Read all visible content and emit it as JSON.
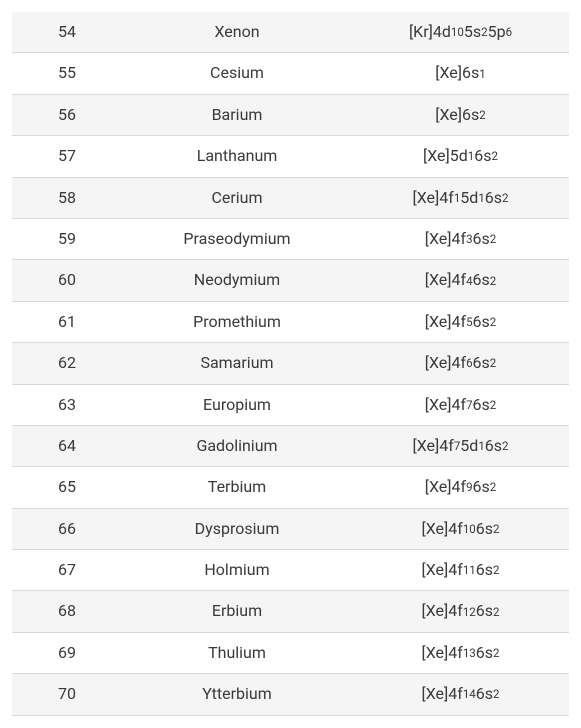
{
  "elements": [
    {
      "number": "54",
      "name": "Xenon",
      "config": [
        [
          "[Kr]4d",
          "10"
        ],
        [
          "5s",
          "2"
        ],
        [
          "5p",
          "6"
        ]
      ]
    },
    {
      "number": "55",
      "name": "Cesium",
      "config": [
        [
          "[Xe]6s",
          "1"
        ]
      ]
    },
    {
      "number": "56",
      "name": "Barium",
      "config": [
        [
          "[Xe]6s",
          "2"
        ]
      ]
    },
    {
      "number": "57",
      "name": "Lanthanum",
      "config": [
        [
          "[Xe]5d",
          "1"
        ],
        [
          "6s",
          "2"
        ]
      ]
    },
    {
      "number": "58",
      "name": "Cerium",
      "config": [
        [
          "[Xe]4f",
          "1"
        ],
        [
          "5d",
          "1"
        ],
        [
          "6s",
          "2"
        ]
      ]
    },
    {
      "number": "59",
      "name": "Praseodymium",
      "config": [
        [
          "[Xe]4f",
          "3"
        ],
        [
          "6s",
          "2"
        ]
      ]
    },
    {
      "number": "60",
      "name": "Neodymium",
      "config": [
        [
          "[Xe]4f",
          "4"
        ],
        [
          "6s",
          "2"
        ]
      ]
    },
    {
      "number": "61",
      "name": "Promethium",
      "config": [
        [
          "[Xe]4f",
          "5"
        ],
        [
          "6s",
          "2"
        ]
      ]
    },
    {
      "number": "62",
      "name": "Samarium",
      "config": [
        [
          "[Xe]4f",
          "6"
        ],
        [
          "6s",
          "2"
        ]
      ]
    },
    {
      "number": "63",
      "name": "Europium",
      "config": [
        [
          "[Xe]4f",
          "7"
        ],
        [
          "6s",
          "2"
        ]
      ]
    },
    {
      "number": "64",
      "name": "Gadolinium",
      "config": [
        [
          "[Xe]4f",
          "7"
        ],
        [
          "5d",
          "1"
        ],
        [
          "6s",
          "2"
        ]
      ]
    },
    {
      "number": "65",
      "name": "Terbium",
      "config": [
        [
          "[Xe]4f",
          "9"
        ],
        [
          "6s",
          "2"
        ]
      ]
    },
    {
      "number": "66",
      "name": "Dysprosium",
      "config": [
        [
          "[Xe]4f",
          "10"
        ],
        [
          "6s",
          "2"
        ]
      ]
    },
    {
      "number": "67",
      "name": "Holmium",
      "config": [
        [
          "[Xe]4f",
          "11"
        ],
        [
          "6s",
          "2"
        ]
      ]
    },
    {
      "number": "68",
      "name": "Erbium",
      "config": [
        [
          "[Xe]4f",
          "12"
        ],
        [
          "6s",
          "2"
        ]
      ]
    },
    {
      "number": "69",
      "name": "Thulium",
      "config": [
        [
          "[Xe]4f",
          "13"
        ],
        [
          "6s",
          "2"
        ]
      ]
    },
    {
      "number": "70",
      "name": "Ytterbium",
      "config": [
        [
          "[Xe]4f",
          "14"
        ],
        [
          "6s",
          "2"
        ]
      ]
    }
  ]
}
